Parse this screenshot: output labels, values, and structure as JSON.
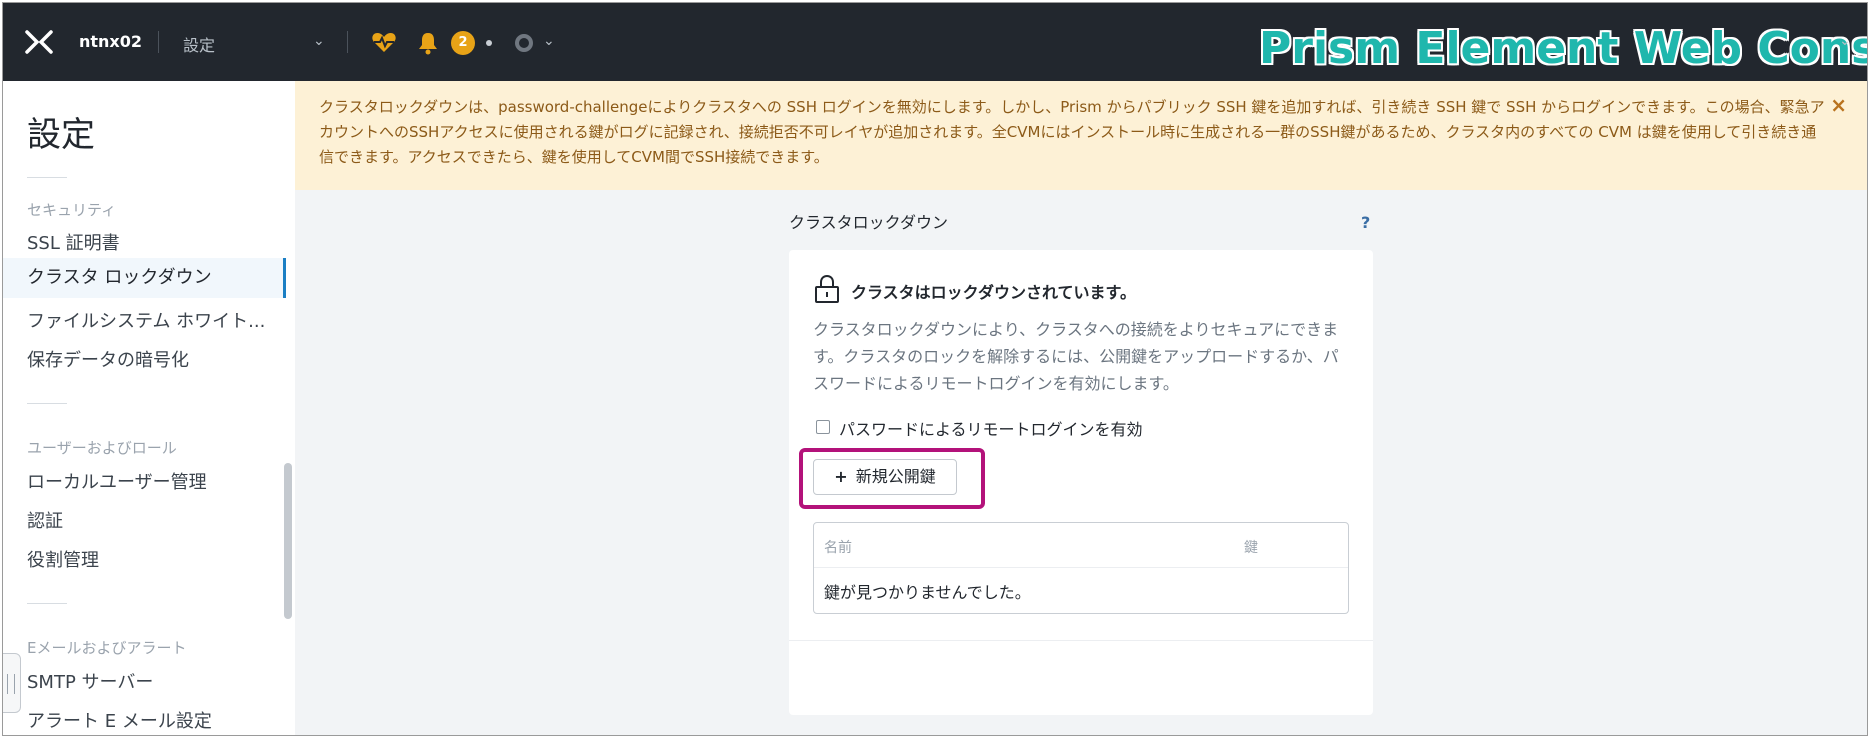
{
  "header": {
    "cluster_name": "ntnx02",
    "page_name": "設定",
    "alert_count": "2",
    "console_title": "Prism Element Web Console"
  },
  "sidebar": {
    "title": "設定",
    "groups": [
      {
        "label": "セキュリティ",
        "items": [
          "SSL 証明書",
          "クラスタ ロックダウン",
          "ファイルシステム ホワイト...",
          "保存データの暗号化"
        ]
      },
      {
        "label": "ユーザーおよびロール",
        "items": [
          "ローカルユーザー管理",
          "認証",
          "役割管理"
        ]
      },
      {
        "label": "Eメールおよびアラート",
        "items": [
          "SMTP サーバー",
          "アラート E メール設定"
        ]
      }
    ],
    "active_item": "クラスタ ロックダウン"
  },
  "warning": {
    "text": "クラスタロックダウンは、password-challengeによりクラスタへの SSH ログインを無効にします。しかし、Prism からパブリック SSH 鍵を追加すれば、引き続き SSH 鍵で SSH からログインできます。この場合、緊急アカウントへのSSHアクセスに使用される鍵がログに記録され、接続拒否不可レイヤが追加されます。全CVMにはインストール時に生成される一群のSSH鍵があるため、クラスタ内のすべての CVM は鍵を使用して引き続き通信できます。アクセスできたら、鍵を使用してCVM間でSSH接続できます。",
    "close": "×"
  },
  "main": {
    "section_title": "クラスタロックダウン",
    "help": "?",
    "lock_status": "クラスタはロックダウンされています。",
    "description": "クラスタロックダウンにより、クラスタへの接続をよりセキュアにできます。クラスタのロックを解除するには、公開鍵をアップロードするか、パスワードによるリモートログインを有効にします。",
    "checkbox_label": "パスワードによるリモートログインを有効",
    "add_key_label": "新規公開鍵",
    "table": {
      "columns": [
        "名前",
        "鍵"
      ],
      "empty_message": "鍵が見つかりませんでした。"
    }
  },
  "colors": {
    "topbar": "#22272e",
    "accent": "#1b7fc4",
    "badge": "#e8a317",
    "highlight": "#b3127a",
    "warning_bg": "#fdf1d6",
    "title_teal": "#1fb7ad"
  },
  "icons": [
    "nutanix-x-logo",
    "heart-health-icon",
    "bell-icon",
    "circle-status-icon",
    "lock-icon",
    "help-icon",
    "close-icon"
  ]
}
